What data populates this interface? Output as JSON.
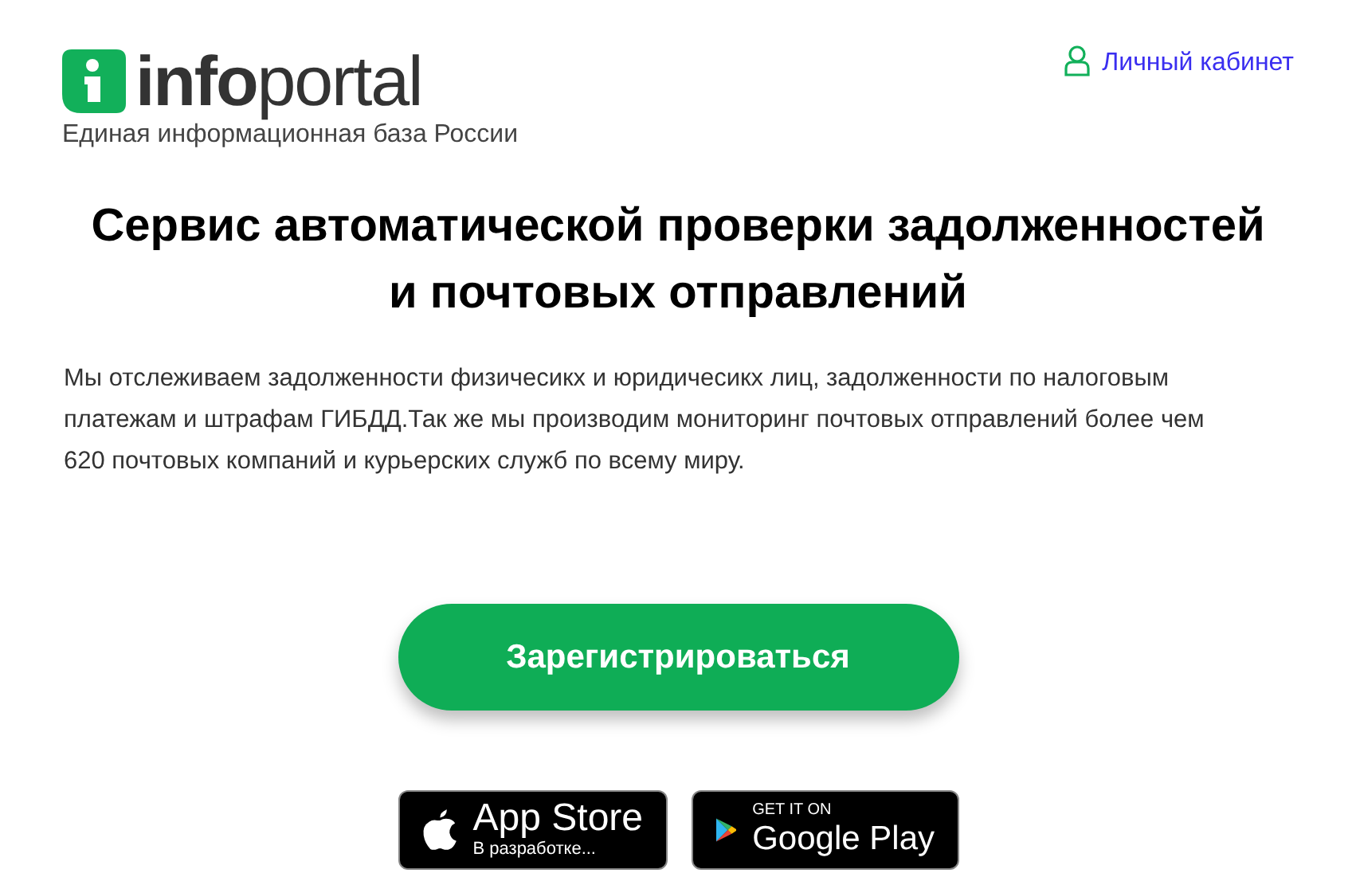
{
  "header": {
    "logo": {
      "bold": "info",
      "regular": "portal"
    },
    "tagline": "Единая информационная база России",
    "account_link": "Личный кабинет"
  },
  "title_lines": [
    "Сервис автоматической проверки задолженностей",
    "и почтовых отправлений"
  ],
  "description": "Мы отслеживаем задолженности физичесикх и юридичесикх лиц, задолженности по налоговым платежам и штрафам ГИБДД.Так же мы производим мониторинг почтовых отправлений более чем 620 почтовых компаний и курьерских служб по всему миру.",
  "register_button": "Зарегистрироваться",
  "store_badges": [
    {
      "kind": "apple",
      "title": "App Store",
      "subtitle": "В разработке..."
    },
    {
      "kind": "google",
      "title": "Google Play",
      "subtitle": "GET IT ON"
    }
  ]
}
